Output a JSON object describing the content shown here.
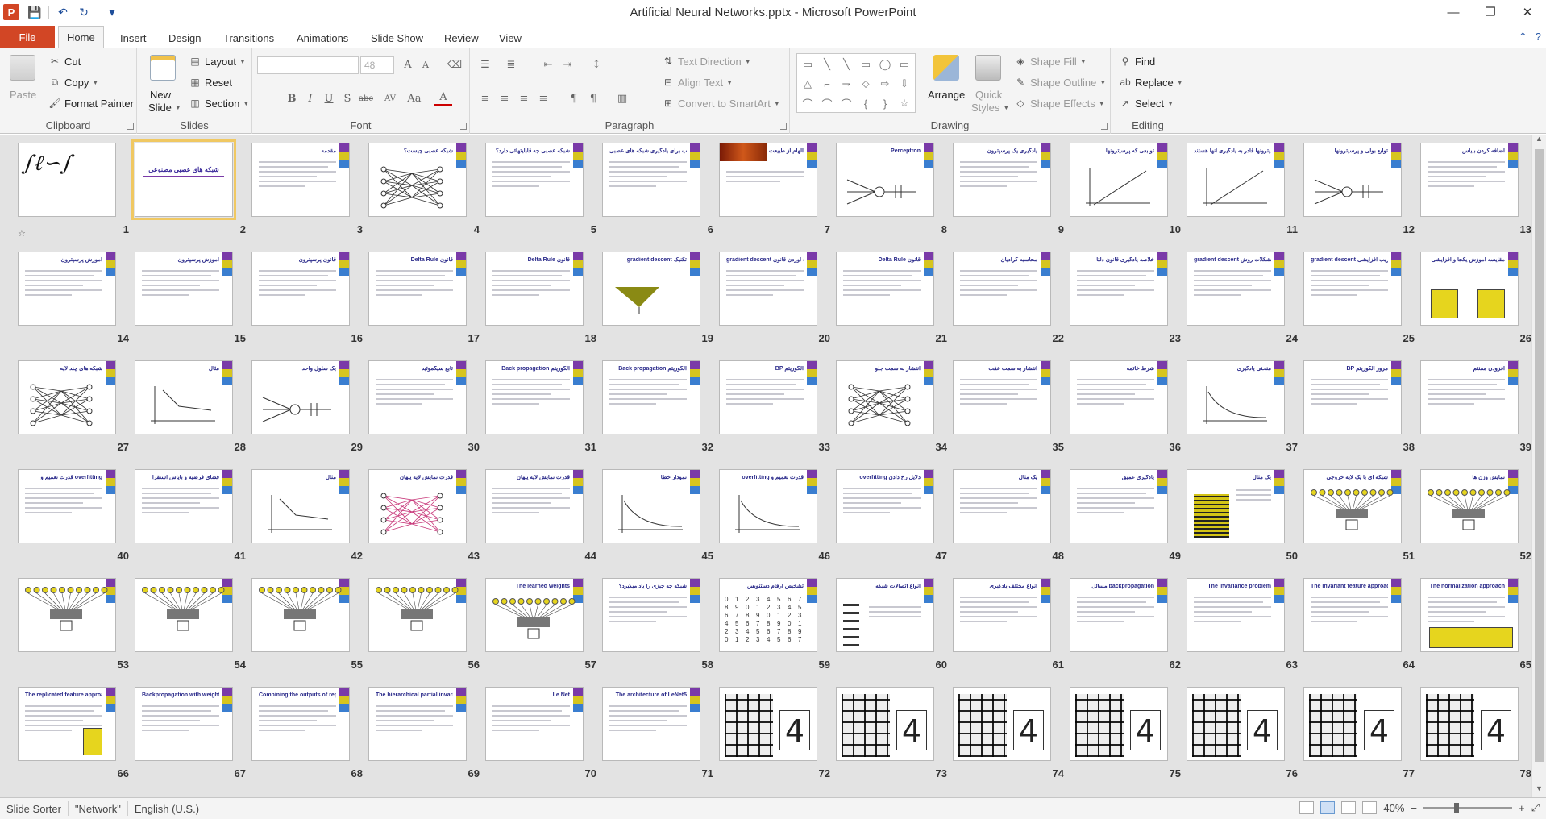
{
  "window": {
    "title": "Artificial Neural Networks.pptx - Microsoft PowerPoint",
    "app_letter": "P",
    "controls": {
      "minimize": "—",
      "restore": "❐",
      "close": "✕"
    }
  },
  "qat": {
    "save": "💾",
    "undo": "↶",
    "redo": "↻",
    "customize": "▾"
  },
  "tabs": {
    "file": "File",
    "items": [
      "Home",
      "Insert",
      "Design",
      "Transitions",
      "Animations",
      "Slide Show",
      "Review",
      "View"
    ],
    "active": "Home"
  },
  "ribbon": {
    "clipboard": {
      "label": "Clipboard",
      "paste": "Paste",
      "cut": "Cut",
      "copy": "Copy",
      "format_painter": "Format Painter"
    },
    "slides": {
      "label": "Slides",
      "new_slide": "New",
      "new_slide2": "Slide",
      "layout": "Layout",
      "reset": "Reset",
      "section": "Section"
    },
    "font": {
      "label": "Font",
      "font_name": "",
      "font_size": "48",
      "grow": "A",
      "shrink": "A",
      "bold": "B",
      "italic": "I",
      "underline": "U",
      "shadow": "S",
      "strike": "abc",
      "spacing": "AV",
      "case": "Aa",
      "color": "A"
    },
    "paragraph": {
      "label": "Paragraph",
      "text_direction": "Text Direction",
      "align_text": "Align Text",
      "convert_smartart": "Convert to SmartArt"
    },
    "drawing": {
      "label": "Drawing",
      "arrange": "Arrange",
      "quick_styles": "Quick",
      "quick_styles2": "Styles",
      "shape_fill": "Shape Fill",
      "shape_outline": "Shape Outline",
      "shape_effects": "Shape Effects",
      "shape_glyphs": [
        "▭",
        "╲",
        "╲",
        "▭",
        "◯",
        "▭",
        "△",
        "⌐",
        "⇁",
        "⬦",
        "⇨",
        "⇩",
        "⌒",
        "⌒",
        "⌒",
        "{",
        "}",
        "☆"
      ]
    },
    "editing": {
      "label": "Editing",
      "find": "Find",
      "replace": "Replace",
      "select": "Select"
    }
  },
  "slides": [
    {
      "n": 1,
      "title": "",
      "kind": "calligraphy"
    },
    {
      "n": 2,
      "title": "شبکه های عصبی مصنوعی",
      "kind": "titleslide",
      "selected": true
    },
    {
      "n": 3,
      "title": "مقدمه",
      "kind": "text"
    },
    {
      "n": 4,
      "title": "شبکه عصبی چیست؟",
      "kind": "network"
    },
    {
      "n": 5,
      "title": "شبکه عصبی چه قابلیتهائی دارد؟",
      "kind": "text"
    },
    {
      "n": 6,
      "title": "مسائل مناسب برای یادگیری شبکه های عصبی",
      "kind": "text"
    },
    {
      "n": 7,
      "title": "الهام از طبیعت",
      "kind": "photo"
    },
    {
      "n": 8,
      "title": "Perceptron",
      "kind": "perceptron"
    },
    {
      "n": 9,
      "title": "یادگیری یک پرسپترون",
      "kind": "text"
    },
    {
      "n": 10,
      "title": "توابعی که پرسپترونها",
      "kind": "axes"
    },
    {
      "n": 11,
      "title": "توابعی که پرسپترونها قادر به یادگیری آنها هستند",
      "kind": "axes"
    },
    {
      "n": 12,
      "title": "توابع بولی و پرسپترونها",
      "kind": "perceptron"
    },
    {
      "n": 13,
      "title": "اضافه کردن بایاس",
      "kind": "text"
    },
    {
      "n": 14,
      "title": "آموزش پرسپترون",
      "kind": "text"
    },
    {
      "n": 15,
      "title": "آموزش پرسپترون",
      "kind": "text"
    },
    {
      "n": 16,
      "title": "قانون پرسپترون",
      "kind": "text"
    },
    {
      "n": 17,
      "title": "Delta Rule قانون",
      "kind": "text"
    },
    {
      "n": 18,
      "title": "Delta Rule قانون",
      "kind": "text"
    },
    {
      "n": 19,
      "title": "gradient descent تکنیک",
      "kind": "surface"
    },
    {
      "n": 20,
      "title": "gradient descent بدست آوردن قانون",
      "kind": "text"
    },
    {
      "n": 21,
      "title": "Delta Rule قانون",
      "kind": "text"
    },
    {
      "n": 22,
      "title": "محاسبه گرادیان",
      "kind": "text"
    },
    {
      "n": 23,
      "title": "خلاصه یادگیری قانون دلتا",
      "kind": "text"
    },
    {
      "n": 24,
      "title": "gradient descent مشکلات روش",
      "kind": "text"
    },
    {
      "n": 25,
      "title": "gradient descent تقریب افزایشی",
      "kind": "text"
    },
    {
      "n": 26,
      "title": "مقایسه آموزش یکجا و افزایشی",
      "kind": "yellowboxes"
    },
    {
      "n": 27,
      "title": "شبکه های چند لایه",
      "kind": "mlp"
    },
    {
      "n": 28,
      "title": "مثال",
      "kind": "scatter"
    },
    {
      "n": 29,
      "title": "یک سلول واحد",
      "kind": "perceptron"
    },
    {
      "n": 30,
      "title": "تابع سیگموئید",
      "kind": "text"
    },
    {
      "n": 31,
      "title": "Back propagation الگوریتم",
      "kind": "text"
    },
    {
      "n": 32,
      "title": "Back propagation الگوریتم",
      "kind": "text"
    },
    {
      "n": 33,
      "title": "BP الگوریتم",
      "kind": "text"
    },
    {
      "n": 34,
      "title": "انتشار به سمت جلو",
      "kind": "mlp"
    },
    {
      "n": 35,
      "title": "انتشار به سمت عقب",
      "kind": "text"
    },
    {
      "n": 36,
      "title": "شرط خاتمه",
      "kind": "text"
    },
    {
      "n": 37,
      "title": "منحنی یادگیری",
      "kind": "curve"
    },
    {
      "n": 38,
      "title": "BP مرور الگوریتم",
      "kind": "text"
    },
    {
      "n": 39,
      "title": "افزودن ممنتم",
      "kind": "text"
    },
    {
      "n": 40,
      "title": "قدرت تعمیم و overfitting",
      "kind": "text"
    },
    {
      "n": 41,
      "title": "فضای فرضیه و بایاس استقرا",
      "kind": "text"
    },
    {
      "n": 42,
      "title": "مثال",
      "kind": "scatter"
    },
    {
      "n": 43,
      "title": "قدرت نمایش لایه پنهان",
      "kind": "pinknet"
    },
    {
      "n": 44,
      "title": "قدرت نمایش لایه پنهان",
      "kind": "text"
    },
    {
      "n": 45,
      "title": "نمودار خطا",
      "kind": "curves"
    },
    {
      "n": 46,
      "title": "overfitting قدرت تعمیم و",
      "kind": "curve"
    },
    {
      "n": 47,
      "title": "overfitting دلایل رخ دادن",
      "kind": "text"
    },
    {
      "n": 48,
      "title": "یک مثال",
      "kind": "text"
    },
    {
      "n": 49,
      "title": "یادگیری عمیق",
      "kind": "text"
    },
    {
      "n": 50,
      "title": "یک مثال",
      "kind": "grid"
    },
    {
      "n": 51,
      "title": "شبکه ای با یک لایه خروجی",
      "kind": "bulbs"
    },
    {
      "n": 52,
      "title": "نمایش وزن ها",
      "kind": "bulbs"
    },
    {
      "n": 53,
      "title": "",
      "kind": "bulbs"
    },
    {
      "n": 54,
      "title": "",
      "kind": "bulbs"
    },
    {
      "n": 55,
      "title": "",
      "kind": "bulbs"
    },
    {
      "n": 56,
      "title": "",
      "kind": "bulbs"
    },
    {
      "n": 57,
      "title": "The learned weights",
      "kind": "bulbs"
    },
    {
      "n": 58,
      "title": "شبکه چه چیزی را یاد میگیرد؟",
      "kind": "text"
    },
    {
      "n": 59,
      "title": "تشخیص ارقام دستنویس",
      "kind": "digits"
    },
    {
      "n": 60,
      "title": "انواع اتصالات شبکه",
      "kind": "people"
    },
    {
      "n": 61,
      "title": "انواع مختلف یادگیری",
      "kind": "text"
    },
    {
      "n": 62,
      "title": "مسائل backpropagation",
      "kind": "text"
    },
    {
      "n": 63,
      "title": "The invariance problem",
      "kind": "text"
    },
    {
      "n": 64,
      "title": "The invariant feature approach",
      "kind": "text"
    },
    {
      "n": 65,
      "title": "The normalization approach",
      "kind": "yellowbar"
    },
    {
      "n": 66,
      "title": "The replicated feature approach",
      "kind": "replicated"
    },
    {
      "n": 67,
      "title": "Backpropagation with weight constraints",
      "kind": "text"
    },
    {
      "n": 68,
      "title": "Combining the outputs of replicated features",
      "kind": "text"
    },
    {
      "n": 69,
      "title": "The hierarchical partial invariance approach",
      "kind": "tree"
    },
    {
      "n": 70,
      "title": "Le Net",
      "kind": "text"
    },
    {
      "n": 71,
      "title": "The architecture of LeNet5",
      "kind": "lenet"
    },
    {
      "n": 72,
      "title": "",
      "kind": "digitgrid"
    },
    {
      "n": 73,
      "title": "",
      "kind": "digitgrid"
    },
    {
      "n": 74,
      "title": "",
      "kind": "digitgrid"
    },
    {
      "n": 75,
      "title": "",
      "kind": "digitgrid"
    },
    {
      "n": 76,
      "title": "",
      "kind": "digitgrid"
    },
    {
      "n": 77,
      "title": "",
      "kind": "digitgrid"
    },
    {
      "n": 78,
      "title": "",
      "kind": "digitgrid"
    }
  ],
  "status": {
    "view": "Slide Sorter",
    "theme": "\"Network\"",
    "language": "English (U.S.)",
    "zoom": "40%",
    "zoom_out": "−",
    "zoom_in": "+"
  }
}
